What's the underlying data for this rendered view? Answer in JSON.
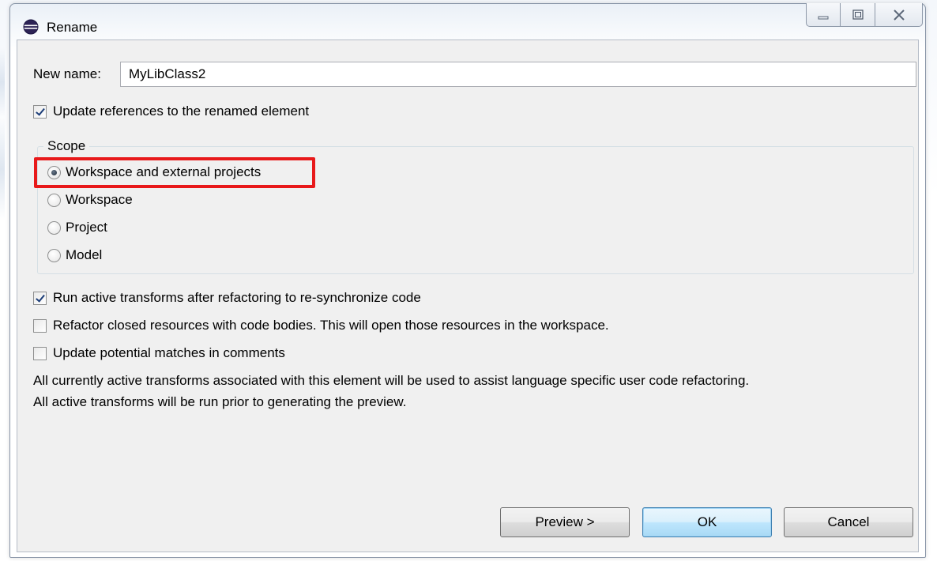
{
  "window": {
    "title": "Rename",
    "minimize_label": "—",
    "maximize_label": "□",
    "close_label": "✕"
  },
  "form": {
    "new_name_label": "New name:",
    "new_name_value": "MyLibClass2",
    "update_references": {
      "label": "Update references to the renamed element",
      "checked": true
    }
  },
  "scope": {
    "title": "Scope",
    "options": [
      {
        "label": "Workspace and external projects",
        "selected": true
      },
      {
        "label": "Workspace",
        "selected": false
      },
      {
        "label": "Project",
        "selected": false
      },
      {
        "label": "Model",
        "selected": false
      }
    ]
  },
  "options": [
    {
      "label": "Run active transforms after refactoring to re-synchronize code",
      "checked": true
    },
    {
      "label": "Refactor closed resources with code bodies. This will open those resources in the workspace.",
      "checked": false
    },
    {
      "label": "Update potential matches in comments",
      "checked": false
    }
  ],
  "info": {
    "line1": "All currently active transforms associated with this element will be used to assist language specific user code refactoring.",
    "line2": "All active transforms will be run prior to generating the preview."
  },
  "buttons": {
    "preview": "Preview >",
    "ok": "OK",
    "cancel": "Cancel"
  },
  "colors": {
    "highlight": "#e8191a",
    "default_button": "#a7d9f5"
  }
}
